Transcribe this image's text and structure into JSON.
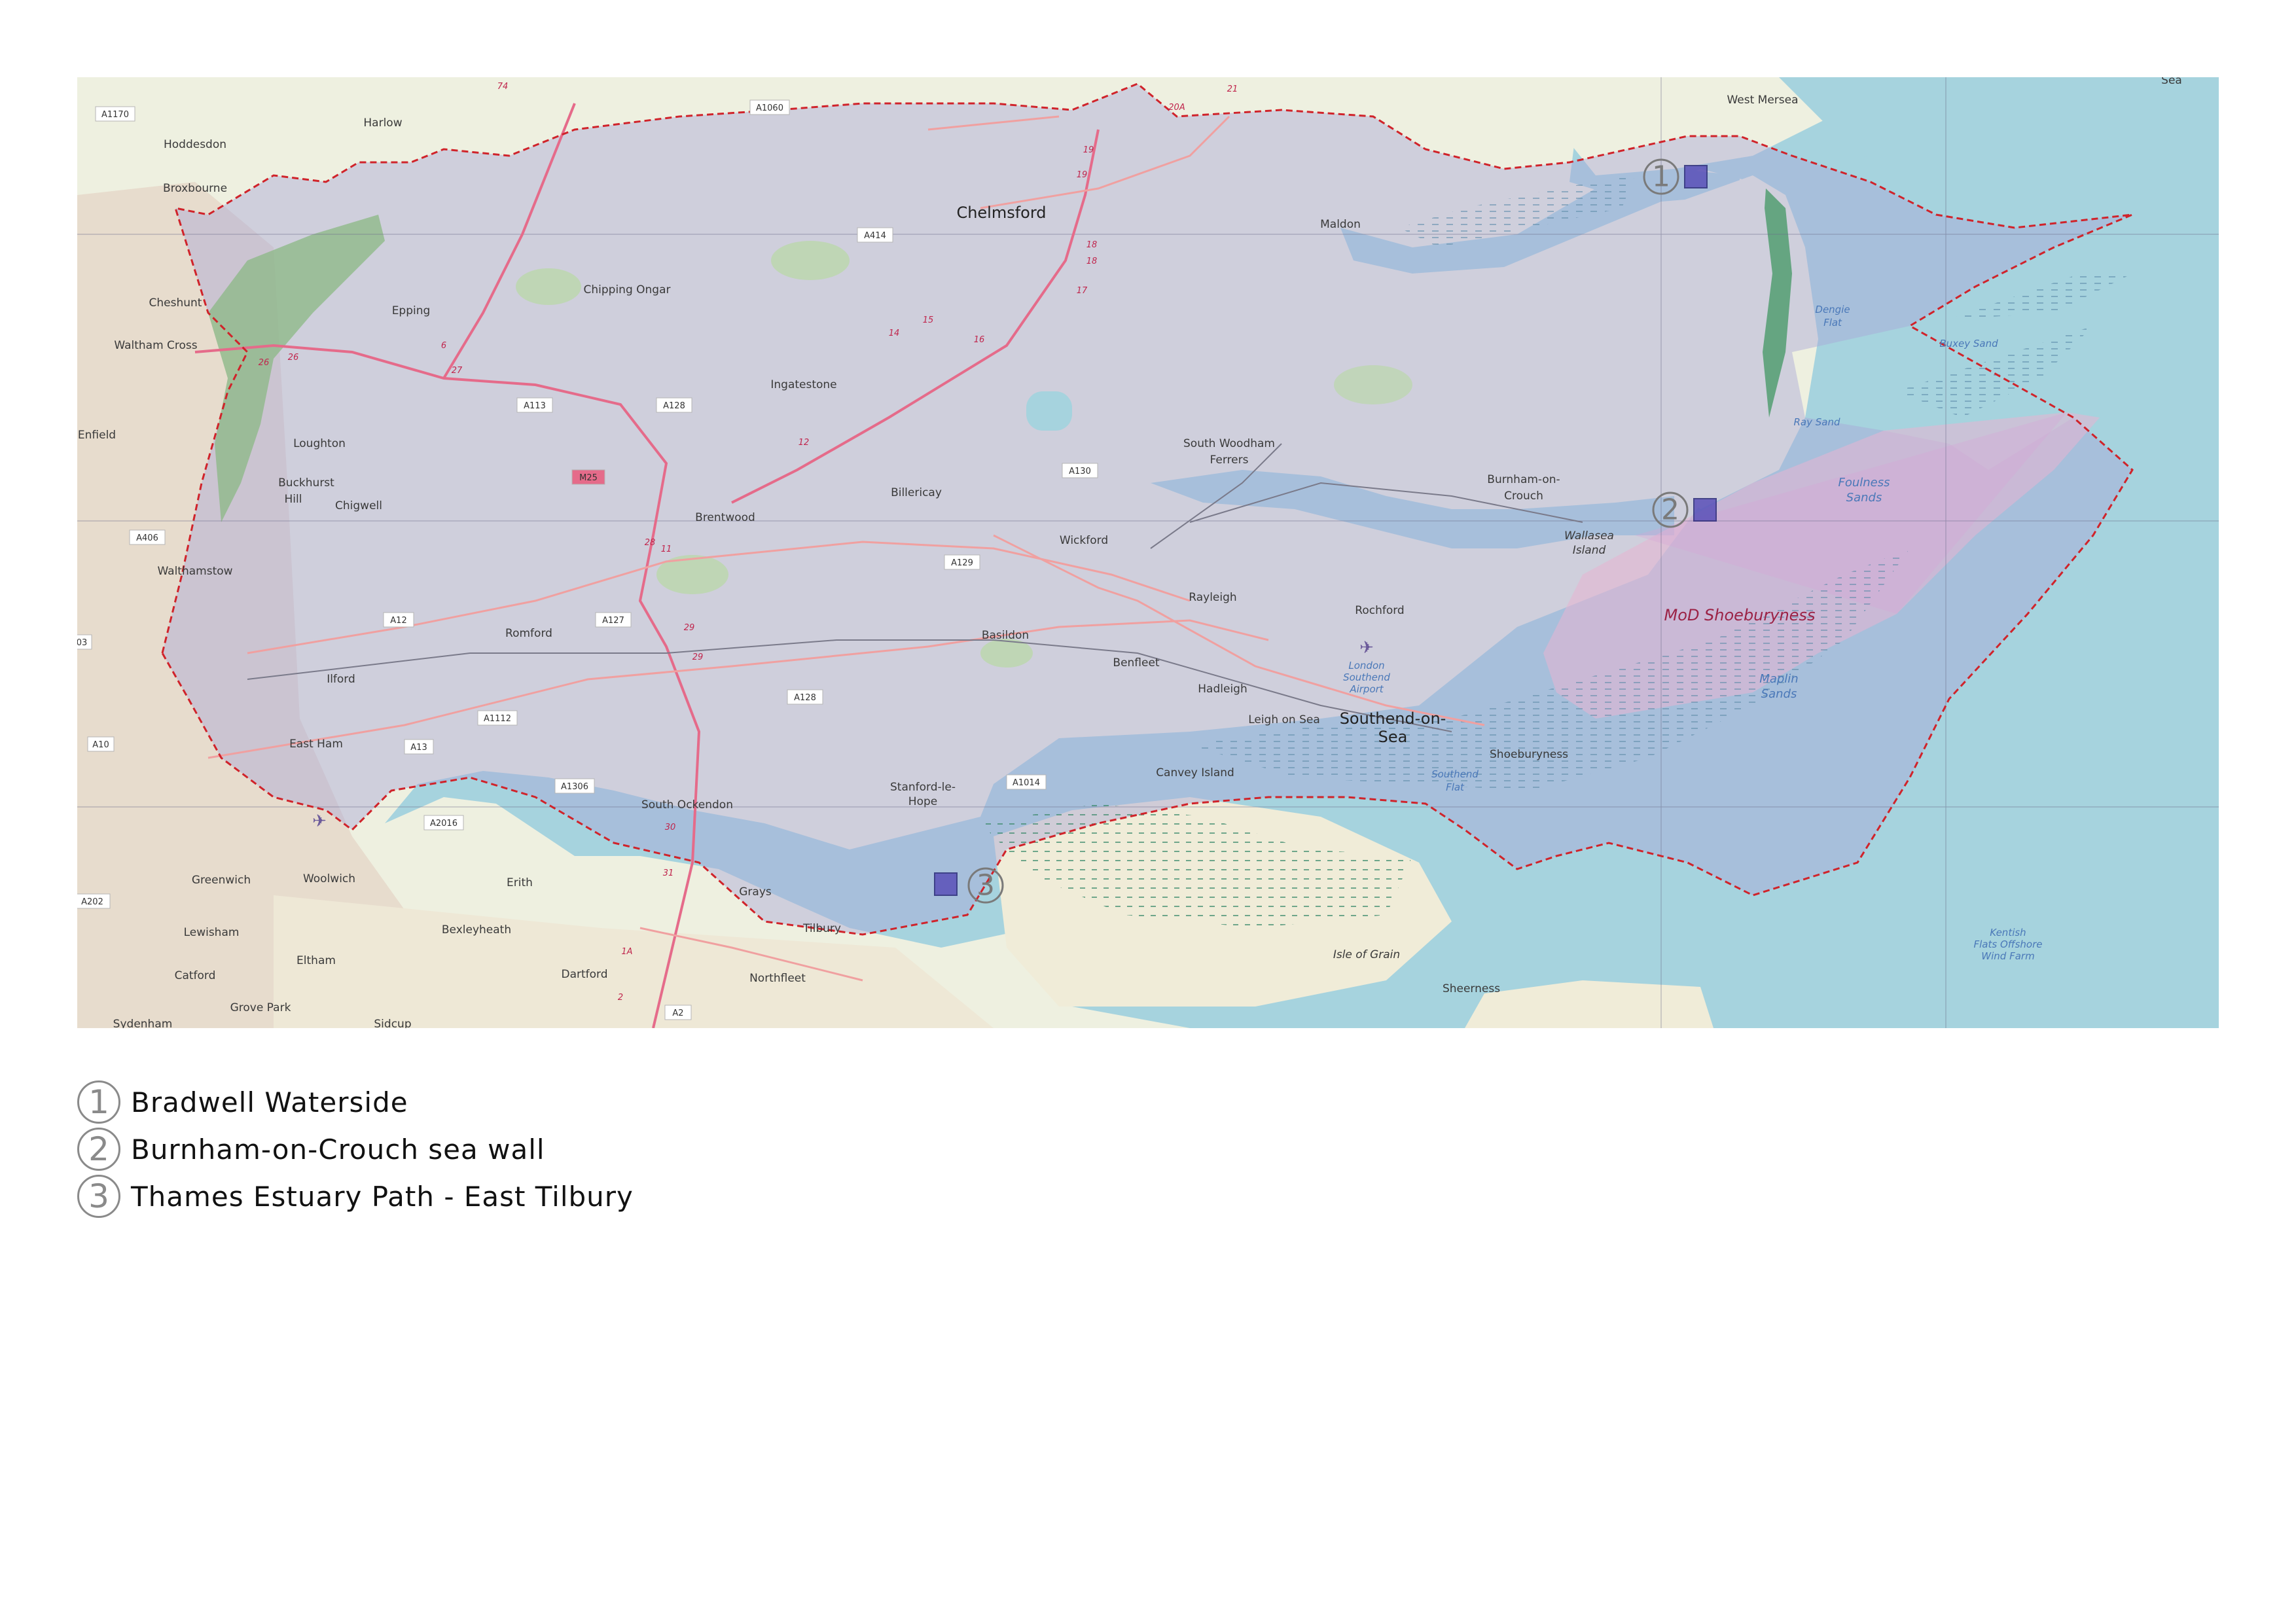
{
  "map": {
    "places": {
      "west_mersea": "West Mersea",
      "harlow": "Harlow",
      "hoddesdon": "Hoddesdon",
      "broxbourne": "Broxbourne",
      "chelmsford": "Chelmsford",
      "maldon": "Maldon",
      "cheshunt": "Cheshunt",
      "waltham_cross": "Waltham Cross",
      "epping": "Epping",
      "chipping_ongar": "Chipping Ongar",
      "ingatestone": "Ingatestone",
      "enfield": "Enfield",
      "loughton": "Loughton",
      "buckhurst_hill_1": "Buckhurst",
      "buckhurst_hill_2": "Hill",
      "chigwell": "Chigwell",
      "brentwood": "Brentwood",
      "billericay": "Billericay",
      "south_woodham_1": "South Woodham",
      "south_woodham_2": "Ferrers",
      "burnham_1": "Burnham-on-",
      "burnham_2": "Crouch",
      "wickford": "Wickford",
      "walthamstow": "Walthamstow",
      "rayleigh": "Rayleigh",
      "rochford": "Rochford",
      "romford": "Romford",
      "basildon": "Basildon",
      "benfleet": "Benfleet",
      "hadleigh": "Hadleigh",
      "ilford": "Ilford",
      "leigh_on_sea": "Leigh on Sea",
      "southend_1": "Southend-on-",
      "southend_2": "Sea",
      "east_ham": "East Ham",
      "shoeburyness": "Shoeburyness",
      "canvey_island": "Canvey Island",
      "stanford_1": "Stanford-le-",
      "stanford_2": "Hope",
      "south_ockendon": "South Ockendon",
      "erith": "Erith",
      "greenwich": "Greenwich",
      "woolwich": "Woolwich",
      "grays": "Grays",
      "tilbury": "Tilbury",
      "lewisham": "Lewisham",
      "bexleyheath": "Bexleyheath",
      "eltham": "Eltham",
      "dartford": "Dartford",
      "catford": "Catford",
      "northfleet": "Northfleet",
      "isle_of_grain": "Isle of Grain",
      "sheerness": "Sheerness",
      "grove_park": "Grove Park",
      "sydenham": "Sydenham",
      "sidcup": "Sidcup",
      "wallasea_1": "Wallasea",
      "wallasea_2": "Island",
      "sea_corner": "Sea"
    },
    "water_labels": {
      "dengie_1": "Dengie",
      "dengie_2": "Flat",
      "buxey": "Buxey Sand",
      "ray_sand": "Ray Sand",
      "foulness_1": "Foulness",
      "foulness_2": "Sands",
      "maplin_1": "Maplin",
      "maplin_2": "Sands",
      "southend_flat_1": "Southend",
      "southend_flat_2": "Flat",
      "airport_1": "London",
      "airport_2": "Southend",
      "airport_3": "Airport",
      "kentish_1": "Kentish",
      "kentish_2": "Flats Offshore",
      "kentish_3": "Wind Farm"
    },
    "danger_area": "MoD Shoeburyness",
    "roads": {
      "a1170": "A1170",
      "a1060": "A1060",
      "a414": "A414",
      "a113": "A113",
      "a128": "A128",
      "m25": "M25",
      "a130": "A130",
      "a406": "A406",
      "a129": "A129",
      "a12": "A12",
      "a127": "A127",
      "a1112": "A1112",
      "a128b": "A128",
      "a10": "A10",
      "a13": "A13",
      "a1306": "A1306",
      "a1014": "A1014",
      "a2016": "A2016",
      "a202": "A202",
      "a2": "A2",
      "a03": "03"
    },
    "junctions": {
      "j21": "21",
      "j20a": "20A",
      "j19a": "19",
      "j19b": "19",
      "j18a": "18",
      "j18b": "18",
      "j17": "17",
      "j15": "15",
      "j14": "14",
      "j16": "16",
      "j26a": "26",
      "j26b": "26",
      "j27": "27",
      "j6": "6",
      "j12": "12",
      "j28": "28",
      "j11": "11",
      "j29a": "29",
      "j29b": "29",
      "j30": "30",
      "j31": "31",
      "j1a": "1A",
      "j2": "2",
      "j74": "74"
    },
    "markers": [
      "1",
      "2",
      "3"
    ]
  },
  "legend": [
    {
      "num": "1",
      "label": "Bradwell Waterside"
    },
    {
      "num": "2",
      "label": "Burnham-on-Crouch sea wall"
    },
    {
      "num": "3",
      "label": "Thames Estuary Path - East Tilbury"
    }
  ],
  "colors": {
    "sea": "#a6d3de",
    "land": "#eef0e0",
    "urban": "#ddd9e6",
    "green": "#b8d8a4",
    "boundary": "#d0232a",
    "motorway": "#e56b8a",
    "study_area": "#a9a6d8"
  }
}
